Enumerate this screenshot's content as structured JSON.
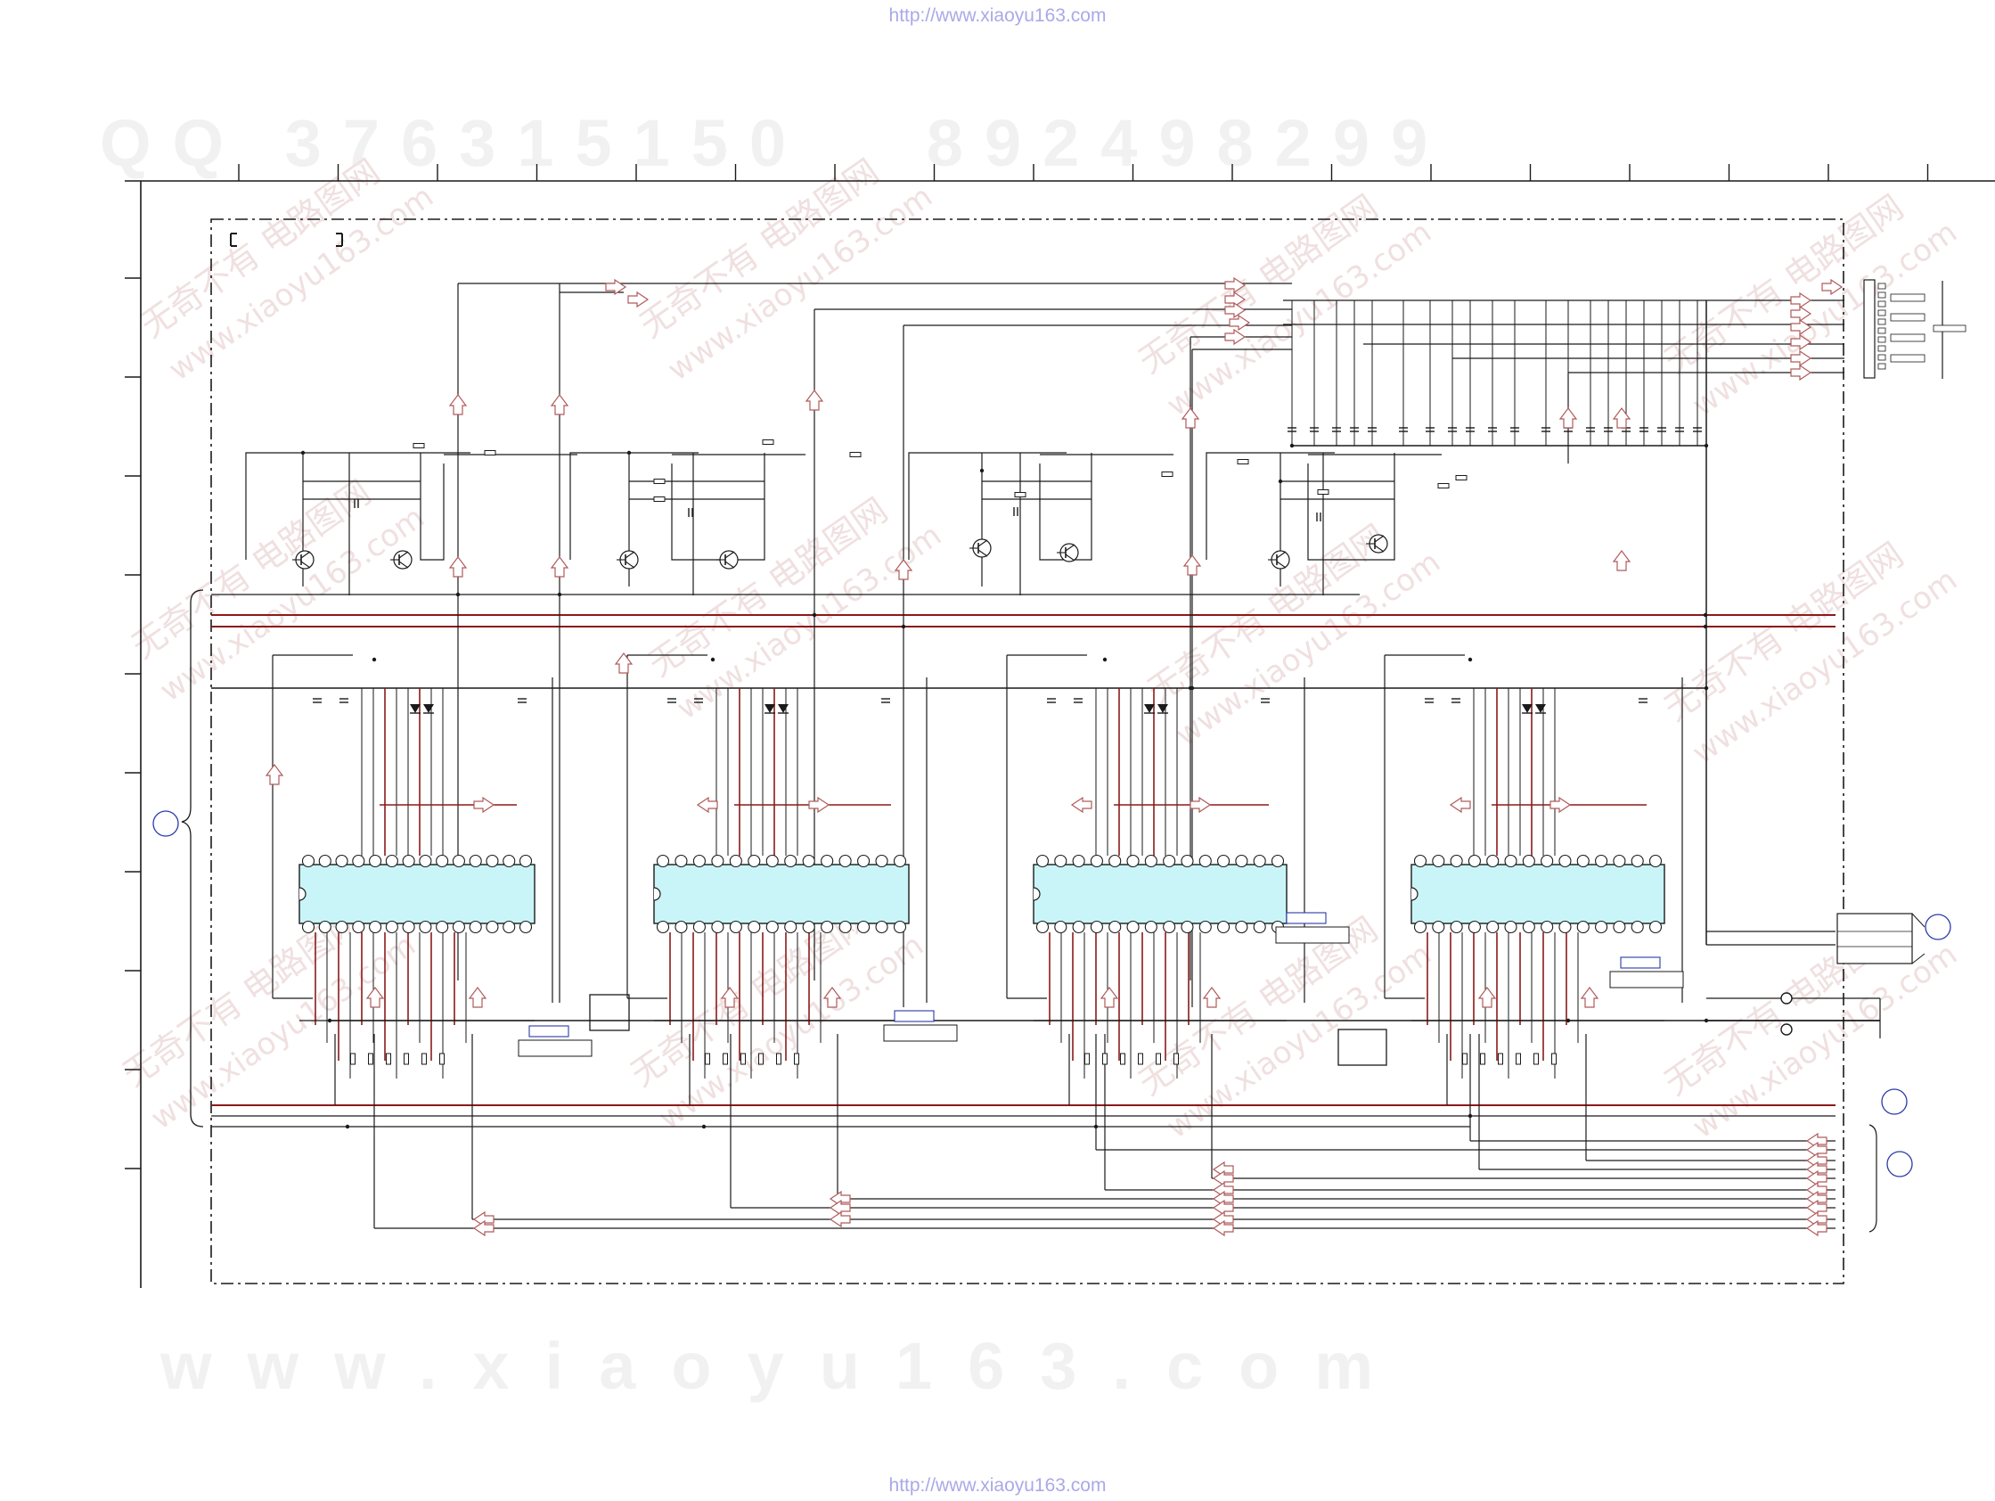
{
  "header": {
    "url_top": "http://www.xiaoyu163.com"
  },
  "footer": {
    "url_bottom": "http://www.xiaoyu163.com"
  },
  "watermarks": {
    "digits": "QQ 376315150   892498299",
    "site": "www.xiaoyu163.com",
    "diagonal_cn": "无奇不有 电路图网",
    "diagonal_url": "www.xiaoyu163.com"
  },
  "colors": {
    "wire": "#1a1a1a",
    "bus": "#8b1a1a",
    "ic_fill": "#c9f5f8",
    "arrow": "#b05a5a",
    "ref_circle": "#2b3aa8",
    "watermark": "#f0e0e0"
  },
  "schematic": {
    "ic_count": 4,
    "pins_per_side": 14,
    "icons": [
      "transistor-icon",
      "diode-icon",
      "connector-icon",
      "jack-icon",
      "ref-circle-icon"
    ]
  }
}
